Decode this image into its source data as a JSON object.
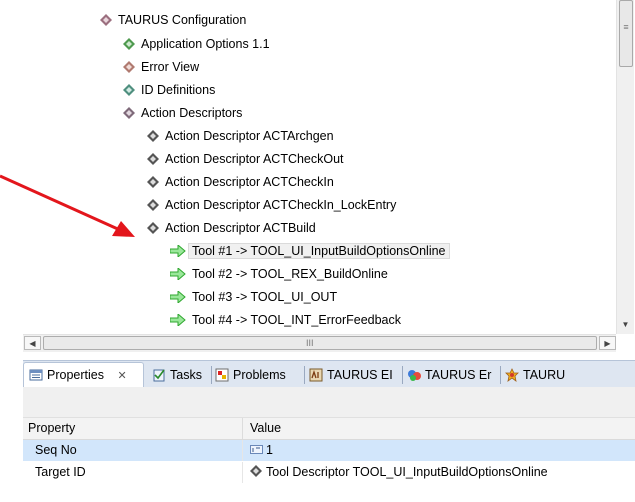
{
  "tree": {
    "items": [
      {
        "label": "TAURUS Configuration",
        "icon": "diamond-icon",
        "color": "#9b6f7f"
      },
      {
        "label": "Application Options 1.1",
        "icon": "diamond-icon",
        "color": "#4f9a4f"
      },
      {
        "label": "Error View",
        "icon": "diamond-icon",
        "color": "#b07a70"
      },
      {
        "label": "ID Definitions",
        "icon": "diamond-icon",
        "color": "#4f8f7f"
      },
      {
        "label": "Action Descriptors",
        "icon": "diamond-icon",
        "color": "#7f6a7a"
      },
      {
        "label": "Action Descriptor ACTArchgen",
        "icon": "diamond-icon",
        "color": "#555555"
      },
      {
        "label": "Action Descriptor ACTCheckOut",
        "icon": "diamond-icon",
        "color": "#555555"
      },
      {
        "label": "Action Descriptor ACTCheckIn",
        "icon": "diamond-icon",
        "color": "#555555"
      },
      {
        "label": "Action Descriptor ACTCheckIn_LockEntry",
        "icon": "diamond-icon",
        "color": "#555555"
      },
      {
        "label": "Action Descriptor ACTBuild",
        "icon": "diamond-icon",
        "color": "#555555"
      },
      {
        "label": "Tool #1 -> TOOL_UI_InputBuildOptionsOnline",
        "icon": "green-arrow-icon",
        "color": "#3fbf3f",
        "selected": true
      },
      {
        "label": "Tool #2 -> TOOL_REX_BuildOnline",
        "icon": "green-arrow-icon",
        "color": "#3fbf3f"
      },
      {
        "label": "Tool #3 -> TOOL_UI_OUT",
        "icon": "green-arrow-icon",
        "color": "#3fbf3f"
      },
      {
        "label": "Tool #4 -> TOOL_INT_ErrorFeedback",
        "icon": "green-arrow-icon",
        "color": "#3fbf3f"
      }
    ]
  },
  "scrollbar": {
    "grip": "≡",
    "hgrip": "III",
    "up": "▲",
    "down": "▼",
    "left": "◀",
    "right": "▶"
  },
  "tabs": [
    {
      "label": "Properties",
      "icon": "properties-icon",
      "close": "✕",
      "active": true
    },
    {
      "label": "Tasks",
      "icon": "tasks-icon"
    },
    {
      "label": "Problems",
      "icon": "problems-icon"
    },
    {
      "label": "TAURUS EI",
      "icon": "taurus-ei-icon"
    },
    {
      "label": "TAURUS Er",
      "icon": "taurus-er-icon"
    },
    {
      "label": "TAURU",
      "icon": "taurus-icon"
    }
  ],
  "properties": {
    "header": {
      "property": "Property",
      "value": "Value"
    },
    "rows": [
      {
        "key": "Seq No",
        "value": "1",
        "value_icon": "number-icon",
        "selected": true
      },
      {
        "key": "Target ID",
        "value": "Tool Descriptor TOOL_UI_InputBuildOptionsOnline",
        "value_icon": "diamond-icon"
      }
    ]
  },
  "colors": {
    "annotation_arrow": "#e3161c",
    "selection": "#d2e6fb",
    "tab_strip": "#dee6f1"
  }
}
